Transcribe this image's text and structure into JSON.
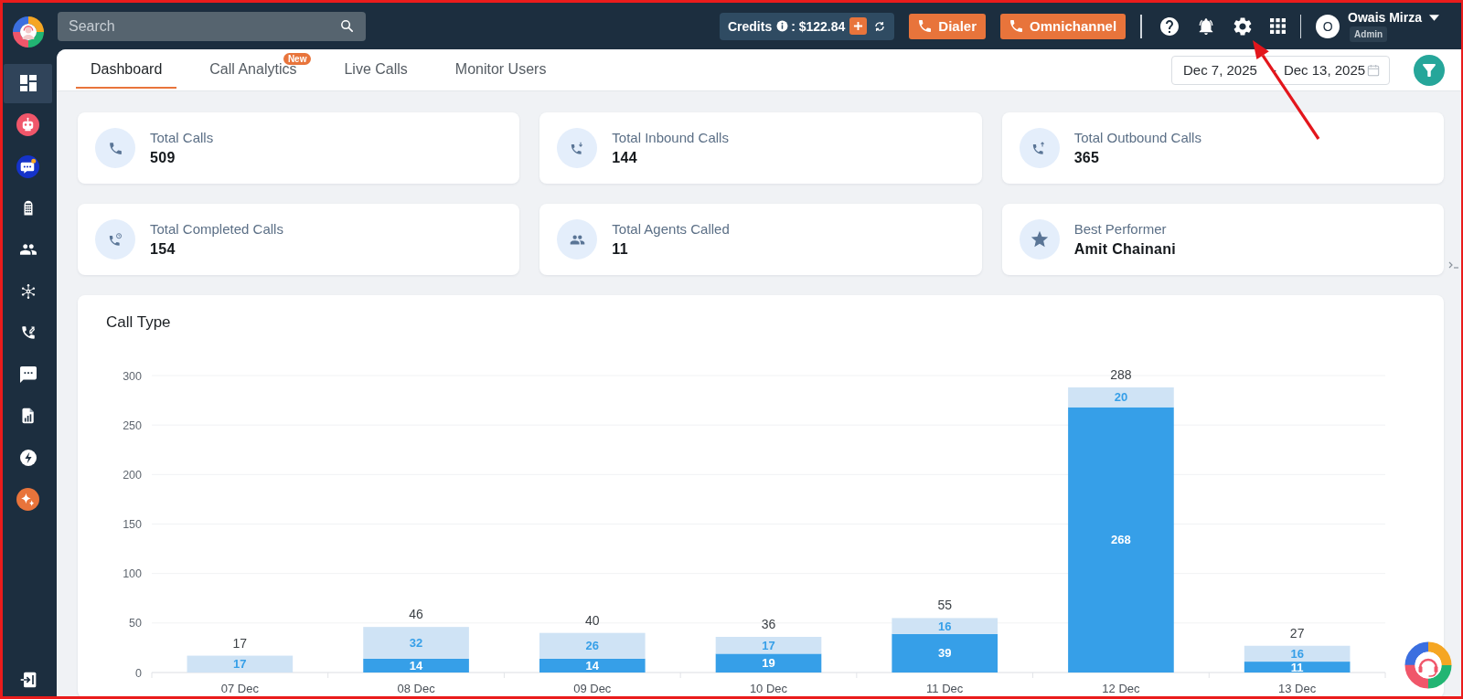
{
  "sidebar": {
    "items": [
      {
        "kind": "dashboard",
        "selected": true
      },
      {
        "kind": "robot",
        "selected": false
      },
      {
        "kind": "chat",
        "selected": false
      },
      {
        "kind": "keypad",
        "selected": false
      },
      {
        "kind": "users",
        "selected": false
      },
      {
        "kind": "hub",
        "selected": false
      },
      {
        "kind": "transfer",
        "selected": false
      },
      {
        "kind": "message",
        "selected": false
      },
      {
        "kind": "report",
        "selected": false
      },
      {
        "kind": "bolt",
        "selected": false
      },
      {
        "kind": "sparkle",
        "selected": false
      }
    ]
  },
  "topbar": {
    "search": {
      "placeholder": "Search"
    },
    "credits": {
      "label": "Credits",
      "amount": ": $122.84"
    },
    "buttons": [
      {
        "label": "Dialer"
      },
      {
        "label": "Omnichannel"
      }
    ],
    "user": {
      "initial": "O",
      "name": "Owais Mirza",
      "role": "Admin"
    }
  },
  "tabs": [
    {
      "label": "Dashboard",
      "selected": true
    },
    {
      "label": "Call Analytics",
      "selected": false,
      "badge": "New"
    },
    {
      "label": "Live Calls",
      "selected": false
    },
    {
      "label": "Monitor Users",
      "selected": false
    }
  ],
  "date_range": {
    "start": "Dec 7, 2025",
    "separator": "-",
    "end": "Dec 13, 2025"
  },
  "stats": [
    {
      "kind": "total",
      "label": "Total Calls",
      "value": "509"
    },
    {
      "kind": "inbound",
      "label": "Total Inbound Calls",
      "value": "144"
    },
    {
      "kind": "outbound",
      "label": "Total Outbound Calls",
      "value": "365"
    },
    {
      "kind": "completed",
      "label": "Total Completed Calls",
      "value": "154"
    },
    {
      "kind": "agents",
      "label": "Total Agents Called",
      "value": "11"
    },
    {
      "kind": "star",
      "label": "Best Performer",
      "value": "Amit Chainani"
    }
  ],
  "call_type": {
    "title": "Call Type",
    "chart_data": {
      "type": "bar",
      "categories": [
        "07 Dec",
        "08 Dec",
        "09 Dec",
        "10 Dec",
        "11 Dec",
        "12 Dec",
        "13 Dec"
      ],
      "series": [
        {
          "color": "#369fe8",
          "values": [
            0,
            14,
            14,
            19,
            39,
            268,
            11
          ]
        },
        {
          "color": "#cfe3f5",
          "values": [
            17,
            32,
            26,
            17,
            16,
            20,
            16
          ]
        }
      ],
      "ylim": [
        0,
        300
      ],
      "yticks": [
        0,
        50,
        100,
        150,
        200,
        250,
        300
      ],
      "grid": true,
      "stacked": true,
      "value_labels": [
        [
          null,
          "14",
          "14",
          "19",
          "39",
          "268",
          "11"
        ],
        [
          "17",
          "32",
          "26",
          "17",
          "16",
          "20",
          "16"
        ]
      ],
      "annotations": [
        "17",
        "46",
        "40",
        "36",
        "55",
        "288",
        "27"
      ]
    }
  }
}
